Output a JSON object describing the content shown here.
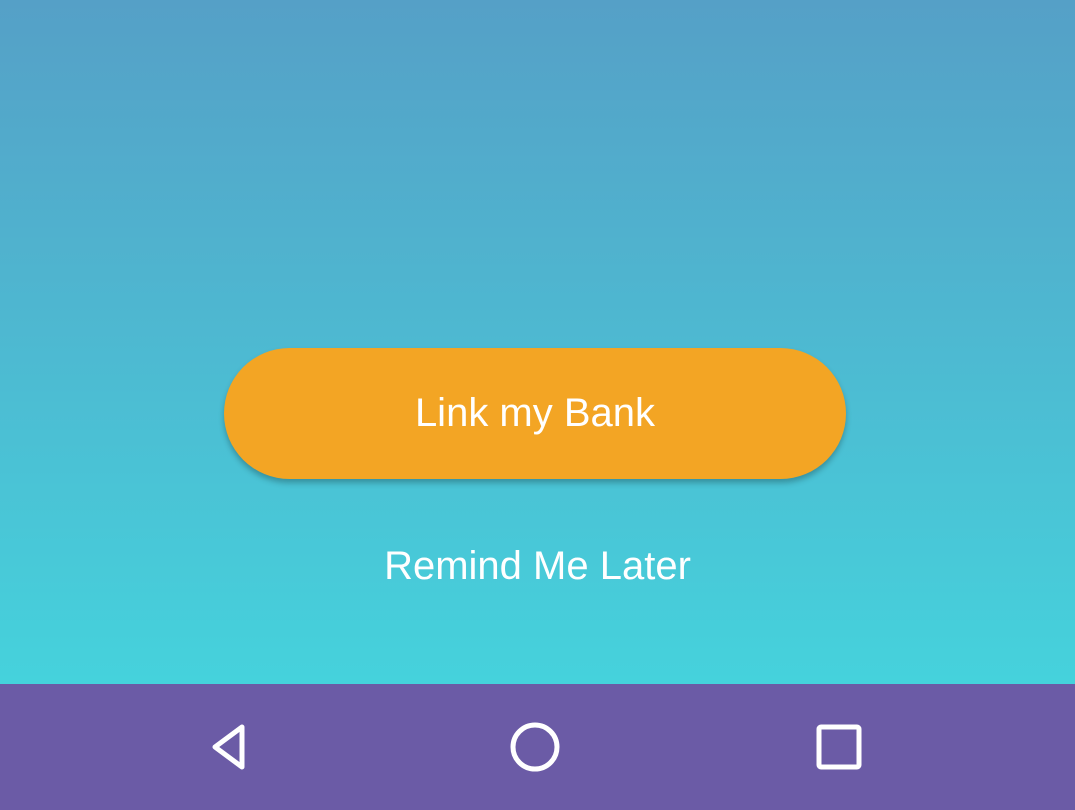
{
  "main": {
    "primary_button_label": "Link my Bank",
    "secondary_link_label": "Remind Me Later"
  },
  "nav_bar": {
    "buttons": [
      {
        "name": "back",
        "icon": "back-triangle-icon"
      },
      {
        "name": "home",
        "icon": "home-circle-icon"
      },
      {
        "name": "recents",
        "icon": "recents-square-icon"
      }
    ]
  },
  "colors": {
    "gradient_top": "#55a0c7",
    "gradient_bottom": "#45d2dc",
    "primary_button": "#f3a524",
    "nav_bar": "#6b5ba6",
    "text": "#ffffff"
  }
}
